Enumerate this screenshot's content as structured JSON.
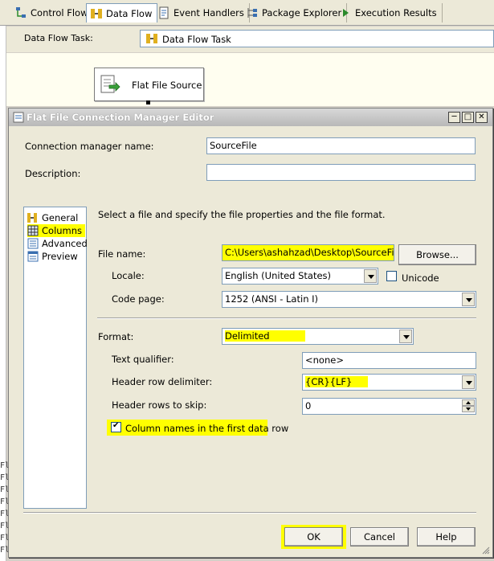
{
  "tabs": [
    {
      "label": "Control Flow",
      "icon": "control-flow-icon"
    },
    {
      "label": "Data Flow",
      "icon": "data-flow-icon",
      "active": true
    },
    {
      "label": "Event Handlers",
      "icon": "event-handlers-icon"
    },
    {
      "label": "Package Explorer",
      "icon": "package-explorer-icon"
    },
    {
      "label": "Execution Results",
      "icon": "execution-results-icon"
    }
  ],
  "task_strip": {
    "label": "Data Flow Task:",
    "value": "Data Flow Task"
  },
  "canvas": {
    "component_label": "Flat File Source"
  },
  "outline": [
    "Fl",
    "Fl",
    "Fl",
    "Fl",
    "Fl",
    "Fl",
    "Fl",
    "Fl"
  ],
  "dialog": {
    "title": "Flat File Connection Manager Editor",
    "connection_name_label": "Connection manager name:",
    "connection_name_value": "SourceFile",
    "description_label": "Description:",
    "description_value": "",
    "nav": [
      {
        "label": "General",
        "icon": "general-icon"
      },
      {
        "label": "Columns",
        "icon": "columns-icon",
        "highlighted": true
      },
      {
        "label": "Advanced",
        "icon": "advanced-icon"
      },
      {
        "label": "Preview",
        "icon": "preview-icon"
      }
    ],
    "instruction": "Select a file and specify the file properties and the file format.",
    "file_name_label": "File name:",
    "file_name_value": "C:\\Users\\ashahzad\\Desktop\\SourceFile.txt",
    "browse_label": "Browse...",
    "locale_label": "Locale:",
    "locale_value": "English (United States)",
    "unicode_label": "Unicode",
    "code_page_label": "Code page:",
    "code_page_value": "1252  (ANSI - Latin I)",
    "format_label": "Format:",
    "format_value": "Delimited",
    "text_qualifier_label": "Text qualifier:",
    "text_qualifier_value": "<none>",
    "header_delimiter_label": "Header row delimiter:",
    "header_delimiter_value": "{CR}{LF}",
    "header_skip_label": "Header rows to skip:",
    "header_skip_value": "0",
    "column_names_label": "Column names in the first data row",
    "ok_label": "OK",
    "cancel_label": "Cancel",
    "help_label": "Help"
  },
  "colors": {
    "highlight": "#ffff00",
    "dialog_bg": "#ece9d8",
    "field_border": "#7f9db9"
  }
}
